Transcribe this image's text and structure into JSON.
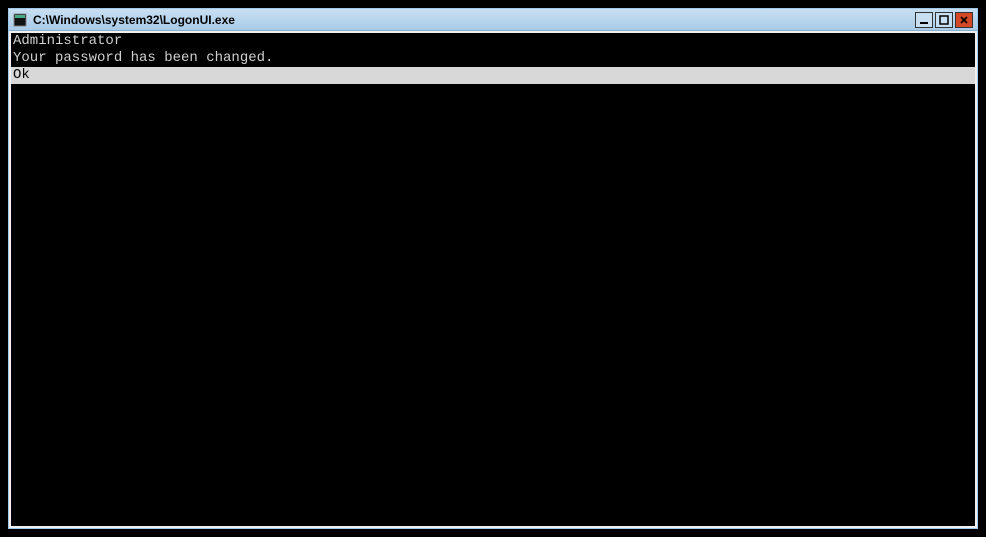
{
  "window": {
    "title": "C:\\Windows\\system32\\LogonUI.exe"
  },
  "console": {
    "line1": "Administrator",
    "line2": "Your password has been changed.",
    "selected": "Ok"
  }
}
